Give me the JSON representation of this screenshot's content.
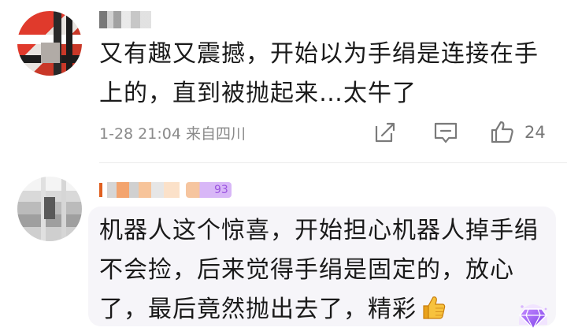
{
  "comment1": {
    "text": "又有趣又震撼，开始以为手绢是连接在手上的，直到被抛起来…太牛了",
    "time": "1-28 21:04",
    "location": "来自四川",
    "like_count": "24"
  },
  "comment2": {
    "badge_text": "93",
    "text": "机器人这个惊喜，开始担心机器人掉手绢不会捡，后来觉得手绢是固定的，放心了，最后竟然抛出去了，精彩"
  },
  "icons": {
    "share": "share-icon",
    "comment": "comment-icon",
    "like": "thumbs-up-icon",
    "emoji": "thumbs-up-emoji-icon",
    "gem": "gem-badge-icon"
  },
  "colors": {
    "meta": "#8a8a8a",
    "bubble": "#f6f5f9",
    "badge": "#9b55e0",
    "avatar_accent": "#e03a2c"
  }
}
